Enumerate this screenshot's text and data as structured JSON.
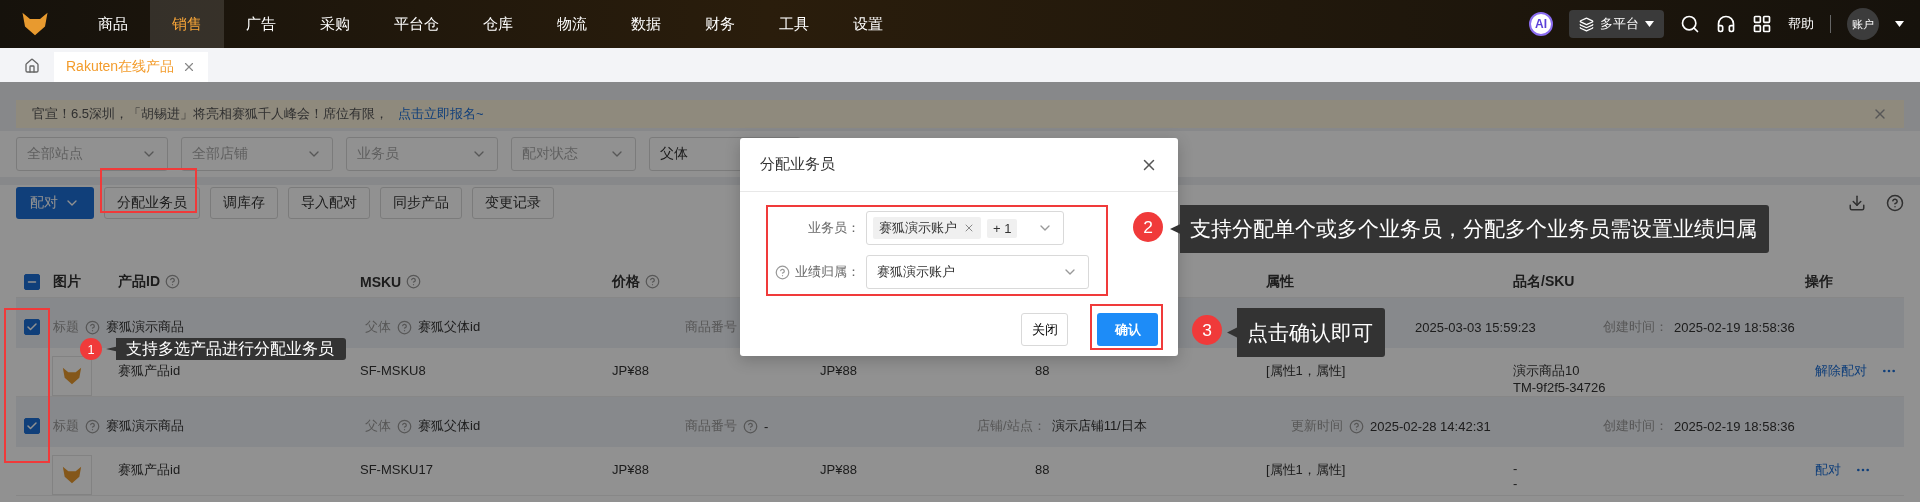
{
  "nav": {
    "items": [
      {
        "label": "商品",
        "selected": false
      },
      {
        "label": "销售",
        "selected": true
      },
      {
        "label": "广告",
        "selected": false
      },
      {
        "label": "采购",
        "selected": false
      },
      {
        "label": "平台仓",
        "selected": false
      },
      {
        "label": "仓库",
        "selected": false
      },
      {
        "label": "物流",
        "selected": false
      },
      {
        "label": "数据",
        "selected": false
      },
      {
        "label": "财务",
        "selected": false
      },
      {
        "label": "工具",
        "selected": false
      },
      {
        "label": "设置",
        "selected": false
      }
    ],
    "ai_badge": "AI",
    "platform": "多平台",
    "help": "帮助",
    "account": "账户"
  },
  "tabs": [
    {
      "label": "Rakuten在线产品",
      "selected": true
    }
  ],
  "banner": {
    "text": "官宣！6.5深圳，「胡锡进」将亮相赛狐千人峰会！席位有限，",
    "link": "点击立即报名~"
  },
  "filters": [
    {
      "placeholder": "全部站点"
    },
    {
      "placeholder": "全部店铺"
    },
    {
      "placeholder": "业务员"
    },
    {
      "placeholder": "配对状态"
    },
    {
      "value": "父体"
    }
  ],
  "toolbar": {
    "primary": "配对",
    "buttons": [
      "分配业务员",
      "调库存",
      "导入配对",
      "同步产品",
      "变更记录"
    ]
  },
  "table": {
    "select_all": {
      "checked": true,
      "indeterminate": true
    },
    "columns": [
      {
        "label": "图片",
        "help": false
      },
      {
        "label": "产品ID",
        "help": true
      },
      {
        "label": "MSKU",
        "help": true
      },
      {
        "label": "价格",
        "help": true
      },
      {
        "label": "属性",
        "help": false
      },
      {
        "label": "品名/SKU",
        "help": false
      },
      {
        "label": "操作",
        "help": false
      }
    ],
    "rows": [
      {
        "checked": true,
        "title_label": "标题",
        "title": "赛狐演示商品",
        "parent_label": "父体",
        "parent": "赛狐父体id",
        "number_label": "商品番号",
        "updated": "2025-03-03 15:59:23",
        "created_label": "创建时间：",
        "created": "2025-02-19 18:58:36",
        "product_id": "赛狐产品id",
        "msku": "SF-MSKU8",
        "price": "JP¥88",
        "price_2": "JP¥88",
        "quantity": "88",
        "attributes": "[属性1，属性]",
        "name": "演示商品10",
        "sku": "TM-9f2f5-34726",
        "actions": [
          "解除配对"
        ]
      },
      {
        "checked": true,
        "title_label": "标题",
        "title": "赛狐演示商品",
        "parent_label": "父体",
        "parent": "赛狐父体id",
        "number_label": "商品番号",
        "number": "-",
        "shop_label": "店铺/站点：",
        "shop": "演示店铺11/日本",
        "updated_label": "更新时间",
        "updated": "2025-02-28 14:42:31",
        "created_label": "创建时间：",
        "created": "2025-02-19 18:58:36",
        "product_id": "赛狐产品id",
        "msku": "SF-MSKU17",
        "price": "JP¥88",
        "price_2": "JP¥88",
        "quantity": "88",
        "attributes": "[属性1，属性]",
        "name": "-",
        "sku": "-",
        "actions": [
          "配对"
        ]
      }
    ]
  },
  "modal": {
    "title": "分配业务员",
    "fields": [
      {
        "label": "业务员：",
        "help": false,
        "tags": [
          "赛狐演示账户"
        ],
        "more": "+ 1"
      },
      {
        "label": "业绩归属：",
        "help": true,
        "value": "赛狐演示账户"
      }
    ],
    "cancel": "关闭",
    "ok": "确认"
  },
  "annotations": [
    {
      "number": "1",
      "text": "支持多选产品进行分配业务员"
    },
    {
      "number": "2",
      "text": "支持分配单个或多个业务员，分配多个业务员需设置业绩归属"
    },
    {
      "number": "3",
      "text": "点击确认即可"
    }
  ]
}
